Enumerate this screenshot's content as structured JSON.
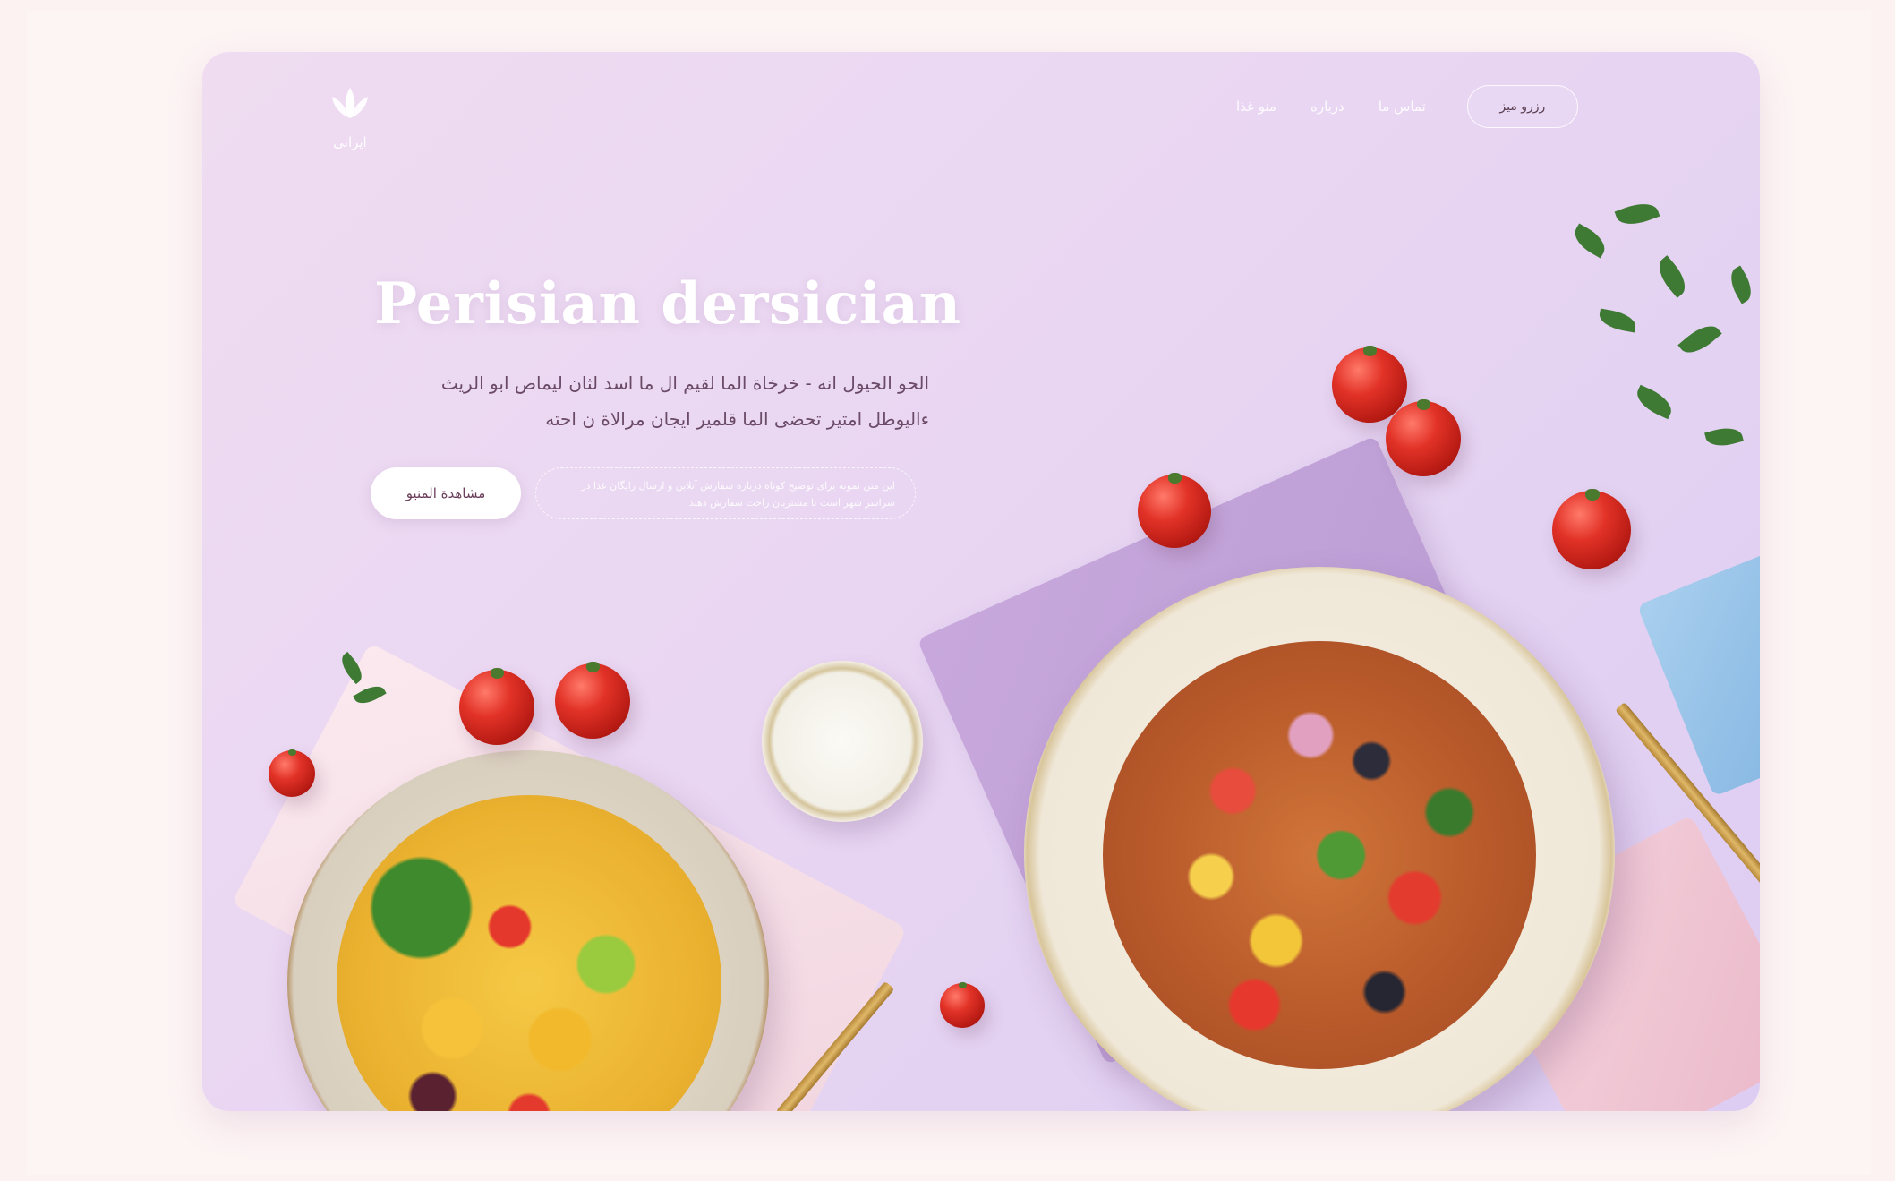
{
  "logo": {
    "icon": "lotus-icon",
    "text": "ایرانی"
  },
  "nav": {
    "links": [
      "منو غذا",
      "درباره",
      "تماس ما"
    ],
    "button_label": "رزرو میز"
  },
  "hero": {
    "title": "Perisian dersician",
    "subtitle_line1": "الحو الحيول انه - خرخاة الما لقيم ال ما اسد لثان ليماص ابو الريث",
    "subtitle_line2": "ءاليوطل امتير تحضى الما قلمير ايجان مرالاة ن احته",
    "cta_label": "مشاهدة المنيو",
    "note": "اين متن نمونه برای توضیح کوتاه درباره سفارش آنلاین و ارسال رایگان غذا در سراسر شهر است تا مشتریان راحت سفارش دهند"
  },
  "colors": {
    "card_bg": "#e9d6f2",
    "page_bg": "#fdf2f2",
    "accent": "#6b3f5a",
    "title": "#ffffff"
  }
}
